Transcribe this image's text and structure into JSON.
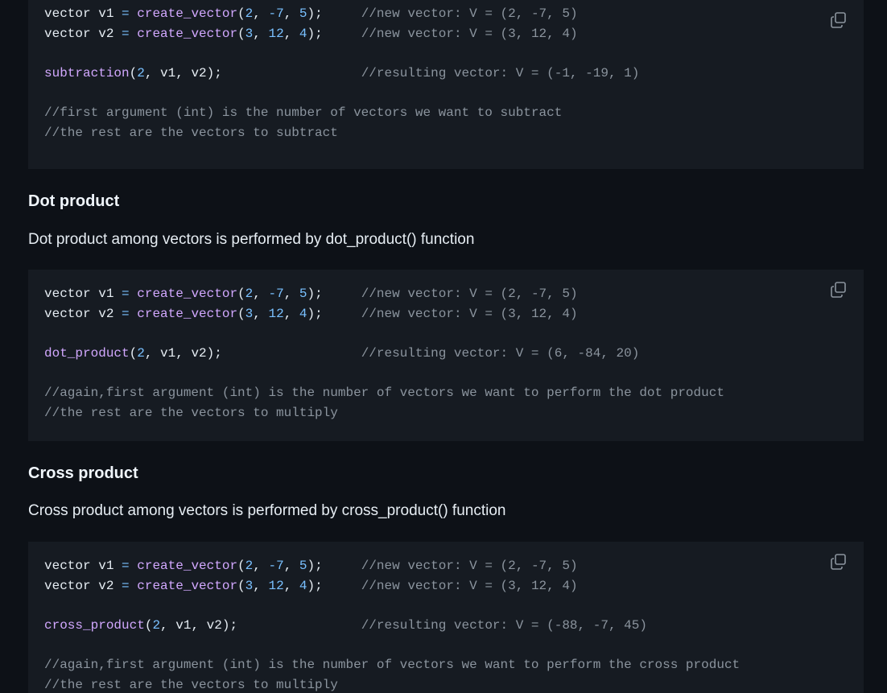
{
  "blocks": [
    {
      "lines": [
        [
          {
            "t": "plain",
            "v": "vector v1 "
          },
          {
            "t": "op",
            "v": "="
          },
          {
            "t": "plain",
            "v": " "
          },
          {
            "t": "fn",
            "v": "create_vector"
          },
          {
            "t": "plain",
            "v": "("
          },
          {
            "t": "num",
            "v": "2"
          },
          {
            "t": "plain",
            "v": ", "
          },
          {
            "t": "num",
            "v": "-7"
          },
          {
            "t": "plain",
            "v": ", "
          },
          {
            "t": "num",
            "v": "5"
          },
          {
            "t": "plain",
            "v": ");     "
          },
          {
            "t": "comment",
            "v": "//new vector: V = (2, -7, 5)"
          }
        ],
        [
          {
            "t": "plain",
            "v": "vector v2 "
          },
          {
            "t": "op",
            "v": "="
          },
          {
            "t": "plain",
            "v": " "
          },
          {
            "t": "fn",
            "v": "create_vector"
          },
          {
            "t": "plain",
            "v": "("
          },
          {
            "t": "num",
            "v": "3"
          },
          {
            "t": "plain",
            "v": ", "
          },
          {
            "t": "num",
            "v": "12"
          },
          {
            "t": "plain",
            "v": ", "
          },
          {
            "t": "num",
            "v": "4"
          },
          {
            "t": "plain",
            "v": ");     "
          },
          {
            "t": "comment",
            "v": "//new vector: V = (3, 12, 4)"
          }
        ],
        [],
        [
          {
            "t": "fn",
            "v": "subtraction"
          },
          {
            "t": "plain",
            "v": "("
          },
          {
            "t": "num",
            "v": "2"
          },
          {
            "t": "plain",
            "v": ", v1, v2);                  "
          },
          {
            "t": "comment",
            "v": "//resulting vector: V = (-1, -19, 1)"
          }
        ],
        [],
        [
          {
            "t": "comment",
            "v": "//first argument (int) is the number of vectors we want to subtract"
          }
        ],
        [
          {
            "t": "comment",
            "v": "//the rest are the vectors to subtract"
          }
        ]
      ]
    },
    {
      "lines": [
        [
          {
            "t": "plain",
            "v": "vector v1 "
          },
          {
            "t": "op",
            "v": "="
          },
          {
            "t": "plain",
            "v": " "
          },
          {
            "t": "fn",
            "v": "create_vector"
          },
          {
            "t": "plain",
            "v": "("
          },
          {
            "t": "num",
            "v": "2"
          },
          {
            "t": "plain",
            "v": ", "
          },
          {
            "t": "num",
            "v": "-7"
          },
          {
            "t": "plain",
            "v": ", "
          },
          {
            "t": "num",
            "v": "5"
          },
          {
            "t": "plain",
            "v": ");     "
          },
          {
            "t": "comment",
            "v": "//new vector: V = (2, -7, 5)"
          }
        ],
        [
          {
            "t": "plain",
            "v": "vector v2 "
          },
          {
            "t": "op",
            "v": "="
          },
          {
            "t": "plain",
            "v": " "
          },
          {
            "t": "fn",
            "v": "create_vector"
          },
          {
            "t": "plain",
            "v": "("
          },
          {
            "t": "num",
            "v": "3"
          },
          {
            "t": "plain",
            "v": ", "
          },
          {
            "t": "num",
            "v": "12"
          },
          {
            "t": "plain",
            "v": ", "
          },
          {
            "t": "num",
            "v": "4"
          },
          {
            "t": "plain",
            "v": ");     "
          },
          {
            "t": "comment",
            "v": "//new vector: V = (3, 12, 4)"
          }
        ],
        [],
        [
          {
            "t": "fn",
            "v": "dot_product"
          },
          {
            "t": "plain",
            "v": "("
          },
          {
            "t": "num",
            "v": "2"
          },
          {
            "t": "plain",
            "v": ", v1, v2);                  "
          },
          {
            "t": "comment",
            "v": "//resulting vector: V = (6, -84, 20)"
          }
        ],
        [],
        [
          {
            "t": "comment",
            "v": "//again,first argument (int) is the number of vectors we want to perform the dot product"
          }
        ],
        [
          {
            "t": "comment",
            "v": "//the rest are the vectors to multiply"
          }
        ]
      ]
    },
    {
      "lines": [
        [
          {
            "t": "plain",
            "v": "vector v1 "
          },
          {
            "t": "op",
            "v": "="
          },
          {
            "t": "plain",
            "v": " "
          },
          {
            "t": "fn",
            "v": "create_vector"
          },
          {
            "t": "plain",
            "v": "("
          },
          {
            "t": "num",
            "v": "2"
          },
          {
            "t": "plain",
            "v": ", "
          },
          {
            "t": "num",
            "v": "-7"
          },
          {
            "t": "plain",
            "v": ", "
          },
          {
            "t": "num",
            "v": "5"
          },
          {
            "t": "plain",
            "v": ");     "
          },
          {
            "t": "comment",
            "v": "//new vector: V = (2, -7, 5)"
          }
        ],
        [
          {
            "t": "plain",
            "v": "vector v2 "
          },
          {
            "t": "op",
            "v": "="
          },
          {
            "t": "plain",
            "v": " "
          },
          {
            "t": "fn",
            "v": "create_vector"
          },
          {
            "t": "plain",
            "v": "("
          },
          {
            "t": "num",
            "v": "3"
          },
          {
            "t": "plain",
            "v": ", "
          },
          {
            "t": "num",
            "v": "12"
          },
          {
            "t": "plain",
            "v": ", "
          },
          {
            "t": "num",
            "v": "4"
          },
          {
            "t": "plain",
            "v": ");     "
          },
          {
            "t": "comment",
            "v": "//new vector: V = (3, 12, 4)"
          }
        ],
        [],
        [
          {
            "t": "fn",
            "v": "cross_product"
          },
          {
            "t": "plain",
            "v": "("
          },
          {
            "t": "num",
            "v": "2"
          },
          {
            "t": "plain",
            "v": ", v1, v2);                "
          },
          {
            "t": "comment",
            "v": "//resulting vector: V = (-88, -7, 45)"
          }
        ],
        [],
        [
          {
            "t": "comment",
            "v": "//again,first argument (int) is the number of vectors we want to perform the cross product"
          }
        ],
        [
          {
            "t": "comment",
            "v": "//the rest are the vectors to multiply"
          }
        ]
      ]
    }
  ],
  "sections": {
    "dot": {
      "heading": "Dot product",
      "text": "Dot product among vectors is performed by dot_product() function"
    },
    "cross": {
      "heading": "Cross product",
      "text": "Cross product among vectors is performed by cross_product() function"
    }
  },
  "icons": {
    "copy": "copy-icon"
  },
  "colors": {
    "background": "#0d1117",
    "code_background": "#161b22",
    "function": "#d2a8ff",
    "number": "#79c0ff",
    "comment": "#8b949e",
    "text": "#e6edf3"
  }
}
